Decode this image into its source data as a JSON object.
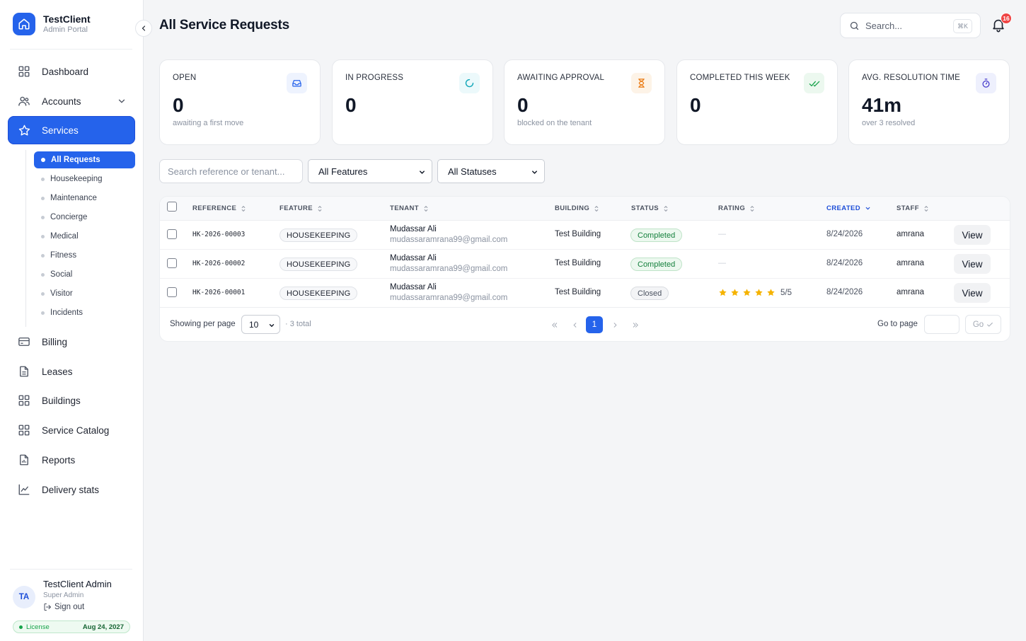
{
  "brand": {
    "name": "TestClient",
    "subtitle": "Admin Portal"
  },
  "sidebar": {
    "items": [
      {
        "label": "Dashboard",
        "icon": "grid-icon"
      },
      {
        "label": "Accounts",
        "icon": "users-icon",
        "expandable": true
      },
      {
        "label": "Services",
        "icon": "star-icon",
        "active": true
      },
      {
        "label": "Billing",
        "icon": "credit-card-icon"
      },
      {
        "label": "Leases",
        "icon": "document-icon"
      },
      {
        "label": "Buildings",
        "icon": "grid-icon"
      },
      {
        "label": "Service Catalog",
        "icon": "grid-icon"
      },
      {
        "label": "Reports",
        "icon": "report-icon"
      },
      {
        "label": "Delivery stats",
        "icon": "line-chart-icon"
      }
    ],
    "services_sub": [
      "All Requests",
      "Housekeeping",
      "Maintenance",
      "Concierge",
      "Medical",
      "Fitness",
      "Social",
      "Visitor",
      "Incidents"
    ],
    "user": {
      "initials": "TA",
      "name": "TestClient Admin",
      "role": "Super Admin",
      "signout": "Sign out"
    },
    "license": {
      "label": "License",
      "date": "Aug 24, 2027"
    }
  },
  "header": {
    "title": "All Service Requests",
    "search_placeholder": "Search...",
    "search_shortcut": "⌘K",
    "notification_count": "16"
  },
  "stats": [
    {
      "label": "OPEN",
      "value": "0",
      "sub": "awaiting a first move",
      "icon": "inbox-icon",
      "color": "#2563eb",
      "bg": "#eef3fe"
    },
    {
      "label": "IN PROGRESS",
      "value": "0",
      "sub": "",
      "icon": "loader-icon",
      "color": "#0ea5b7",
      "bg": "#ecf9fb"
    },
    {
      "label": "AWAITING APPROVAL",
      "value": "0",
      "sub": "blocked on the tenant",
      "icon": "hourglass-icon",
      "color": "#ea7a12",
      "bg": "#fdf3e7"
    },
    {
      "label": "COMPLETED THIS WEEK",
      "value": "0",
      "sub": "",
      "icon": "double-check-icon",
      "color": "#16a34a",
      "bg": "#ecf8ef"
    },
    {
      "label": "AVG. RESOLUTION TIME",
      "value": "41m",
      "sub": "over 3 resolved",
      "icon": "stopwatch-icon",
      "color": "#4338ca",
      "bg": "#eef0fd"
    }
  ],
  "filters": {
    "search_placeholder": "Search reference or tenant...",
    "feature": "All Features",
    "status": "All Statuses"
  },
  "table": {
    "columns": [
      "REFERENCE",
      "FEATURE",
      "TENANT",
      "BUILDING",
      "STATUS",
      "RATING",
      "CREATED",
      "STAFF"
    ],
    "sorted_column": "CREATED",
    "rows": [
      {
        "reference": "HK-2026-00003",
        "feature": "HOUSEKEEPING",
        "tenant_name": "Mudassar Ali",
        "tenant_email": "mudassaramrana99@gmail.com",
        "building": "Test Building",
        "status": "Completed",
        "status_type": "completed",
        "rating": "—",
        "stars": 0,
        "created": "8/24/2026",
        "staff": "amrana",
        "action": "View"
      },
      {
        "reference": "HK-2026-00002",
        "feature": "HOUSEKEEPING",
        "tenant_name": "Mudassar Ali",
        "tenant_email": "mudassaramrana99@gmail.com",
        "building": "Test Building",
        "status": "Completed",
        "status_type": "completed",
        "rating": "—",
        "stars": 0,
        "created": "8/24/2026",
        "staff": "amrana",
        "action": "View"
      },
      {
        "reference": "HK-2026-00001",
        "feature": "HOUSEKEEPING",
        "tenant_name": "Mudassar Ali",
        "tenant_email": "mudassaramrana99@gmail.com",
        "building": "Test Building",
        "status": "Closed",
        "status_type": "closed",
        "rating": "5/5",
        "stars": 5,
        "created": "8/24/2026",
        "staff": "amrana",
        "action": "View"
      }
    ]
  },
  "pagination": {
    "per_page_label": "Showing per page",
    "per_page": "10",
    "total": "· 3 total",
    "current_page": "1",
    "goto_label": "Go to page",
    "go_label": "Go"
  }
}
